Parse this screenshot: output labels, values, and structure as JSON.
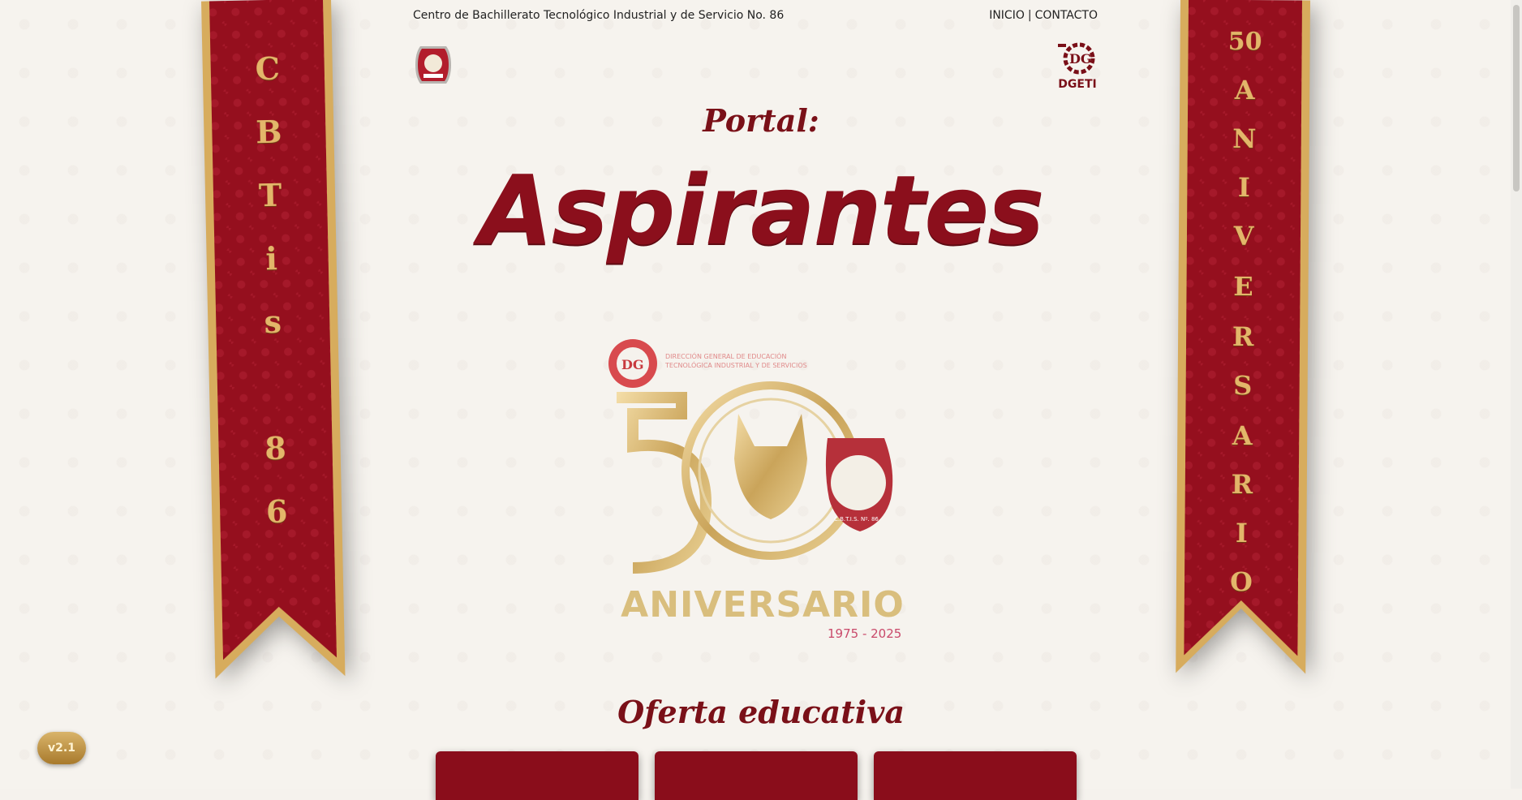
{
  "header": {
    "school_name": "Centro de Bachillerato Tecnológico Industrial y de Servicio No. 86",
    "nav": {
      "inicio": "INICIO",
      "separator": "|",
      "contacto": "CONTACTO"
    },
    "right_logo_text": "DGETI"
  },
  "hero": {
    "portal_label": "Portal:",
    "title": "Aspirantes"
  },
  "ribbons": {
    "left": [
      "C",
      "B",
      "T",
      "i",
      "s",
      "8",
      "6"
    ],
    "right": [
      "50",
      "A",
      "N",
      "I",
      "V",
      "E",
      "R",
      "S",
      "A",
      "R",
      "I",
      "O"
    ]
  },
  "anniversary_logo": {
    "dgeti_text_1": "DIRECCIÓN GENERAL DE EDUCACIÓN",
    "dgeti_text_2": "TECNOLÓGICA INDUSTRIAL Y DE SERVICIOS",
    "aniversario": "ANIVERSARIO",
    "years": "1975 - 2025",
    "seal_text": "C.B.T.I.S. Nº. 86"
  },
  "section": {
    "title": "Oferta educativa"
  },
  "version_badge": "v2.1",
  "colors": {
    "brand": "#8b0f1c",
    "gold": "#d8b56a",
    "background": "#f6f3ee"
  }
}
